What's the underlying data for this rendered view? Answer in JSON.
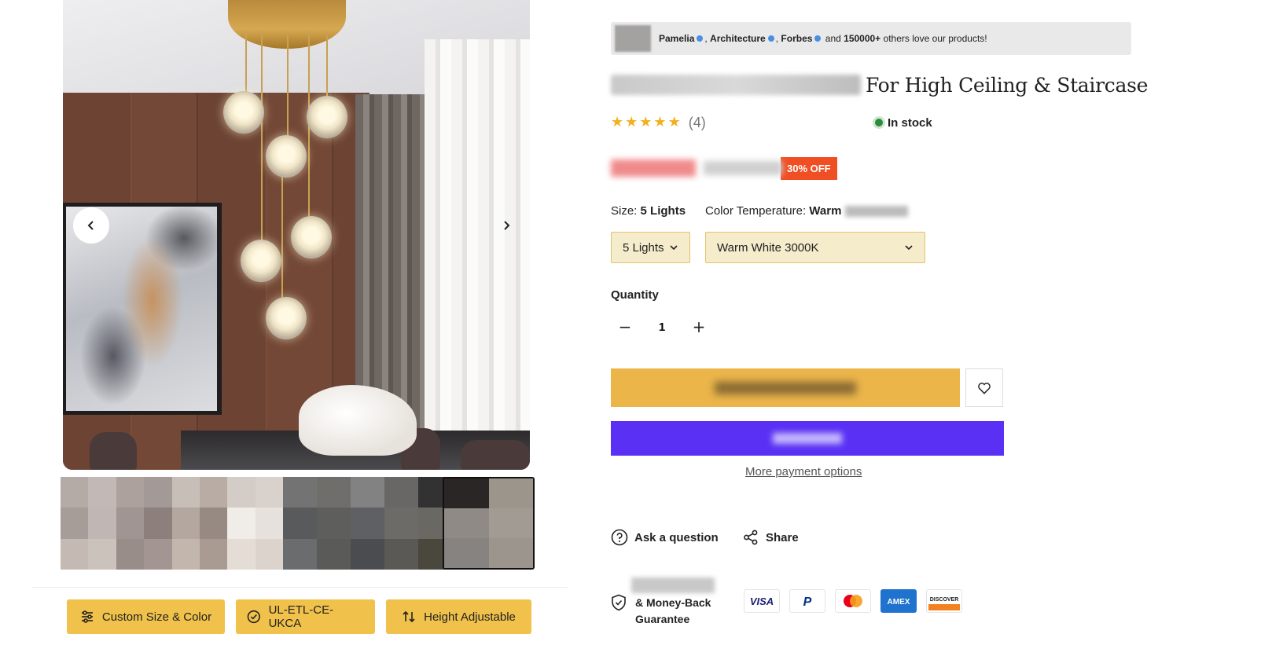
{
  "social_proof": {
    "names": [
      "Pamelia",
      "Architecture",
      "Forbes"
    ],
    "and_text": "and",
    "count": "150000+",
    "suffix": "others love our products!"
  },
  "product": {
    "title_visible": "For High Ceiling & Staircase",
    "rating": 5,
    "review_count": "(4)",
    "stock_status": "In stock",
    "discount_badge": "30% OFF"
  },
  "options": {
    "size_label": "Size:",
    "size_value": "5 Lights",
    "color_label": "Color Temperature:",
    "color_value": "Warm",
    "size_selected": "5 Lights",
    "color_selected": "Warm White 3000K"
  },
  "quantity": {
    "label": "Quantity",
    "value": "1",
    "minus": "−",
    "plus": "+"
  },
  "purchase": {
    "more_payment_options": "More payment options"
  },
  "actions": {
    "ask_question": "Ask a question",
    "share": "Share"
  },
  "guarantee": {
    "text": "& Money-Back Guarantee"
  },
  "payments": [
    "VISA",
    "P",
    "mastercard",
    "AMEX",
    "DISCOVER"
  ],
  "features": {
    "custom_size": "Custom Size & Color",
    "certification": "UL-ETL-CE-UKCA",
    "height": "Height Adjustable"
  },
  "colors": {
    "accent_yellow": "#f0c14b",
    "add_to_cart": "#ebb54a",
    "buy_now": "#5a31f4",
    "discount_red": "#f04e23",
    "star": "#f2b01e",
    "in_stock": "#2e8b3e"
  }
}
